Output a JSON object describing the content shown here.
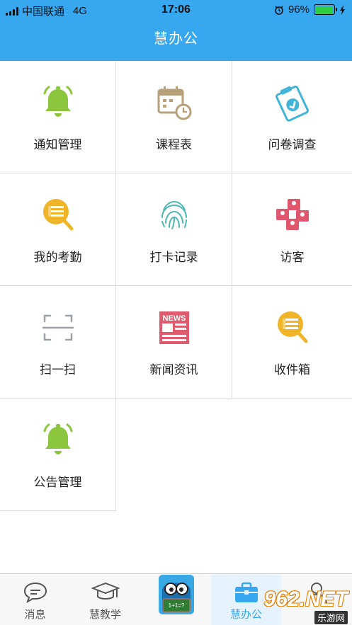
{
  "status_bar": {
    "carrier": "中国联通",
    "network": "4G",
    "time": "17:06",
    "battery": "96%",
    "battery_level": 0.96
  },
  "header": {
    "title": "慧办公"
  },
  "grid": {
    "items": [
      {
        "label": "通知管理",
        "icon": "bell-icon",
        "color": "#8cc63f"
      },
      {
        "label": "课程表",
        "icon": "calendar-clock-icon",
        "color": "#b8a07a"
      },
      {
        "label": "问卷调查",
        "icon": "clipboard-check-icon",
        "color": "#42b4d8"
      },
      {
        "label": "我的考勤",
        "icon": "magnifier-list-icon",
        "color": "#f0b429"
      },
      {
        "label": "打卡记录",
        "icon": "fingerprint-icon",
        "color": "#4fb8b0"
      },
      {
        "label": "访客",
        "icon": "visitor-cards-icon",
        "color": "#e0566d"
      },
      {
        "label": "扫一扫",
        "icon": "scan-icon",
        "color": "#9aa0a6"
      },
      {
        "label": "新闻资讯",
        "icon": "newspaper-icon",
        "color": "#e05a6d"
      },
      {
        "label": "收件箱",
        "icon": "magnifier-list-icon",
        "color": "#f0b429"
      },
      {
        "label": "公告管理",
        "icon": "bell-icon",
        "color": "#8cc63f"
      }
    ],
    "news_word": "NEWS"
  },
  "tabs": [
    {
      "label": "消息",
      "icon": "chat-bubble-icon"
    },
    {
      "label": "慧教学",
      "icon": "graduation-cap-icon"
    },
    {
      "label": "",
      "icon": "mascot-icon"
    },
    {
      "label": "慧办公",
      "icon": "briefcase-icon",
      "active": true
    },
    {
      "label": "",
      "icon": "person-icon"
    }
  ],
  "mascot": {
    "text": "1+1=?"
  },
  "watermark": {
    "top": "962.NET",
    "bottom": "乐游网"
  },
  "colors": {
    "accent": "#37a7f0"
  }
}
